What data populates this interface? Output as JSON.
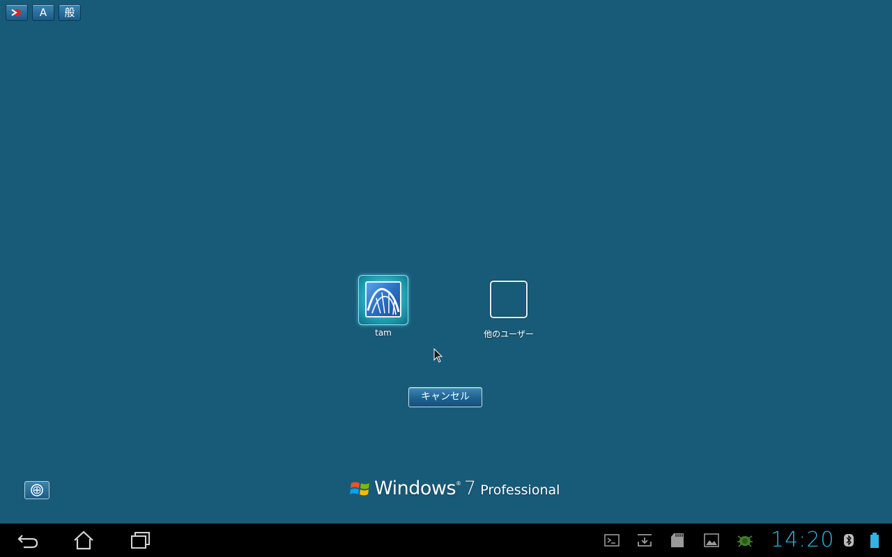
{
  "ime_toolbar": {
    "input_mode_label": "A",
    "dictionary_label": "般"
  },
  "users": [
    {
      "name": "tam",
      "selected": true
    },
    {
      "name": "他のユーザー",
      "selected": false
    }
  ],
  "buttons": {
    "cancel_label": "キャンセル"
  },
  "branding": {
    "product": "Windows",
    "trademark": "®",
    "version": "7",
    "edition": "Professional"
  },
  "system_bar": {
    "clock": "14:20",
    "tray_icons": [
      "terminal-icon",
      "download-icon",
      "sd-card-icon",
      "gallery-icon",
      "android-bug-icon",
      "bluetooth-icon",
      "battery-icon"
    ]
  },
  "colors": {
    "background": "#185b79",
    "clock": "#31b3e4",
    "system_bar": "#000000"
  }
}
